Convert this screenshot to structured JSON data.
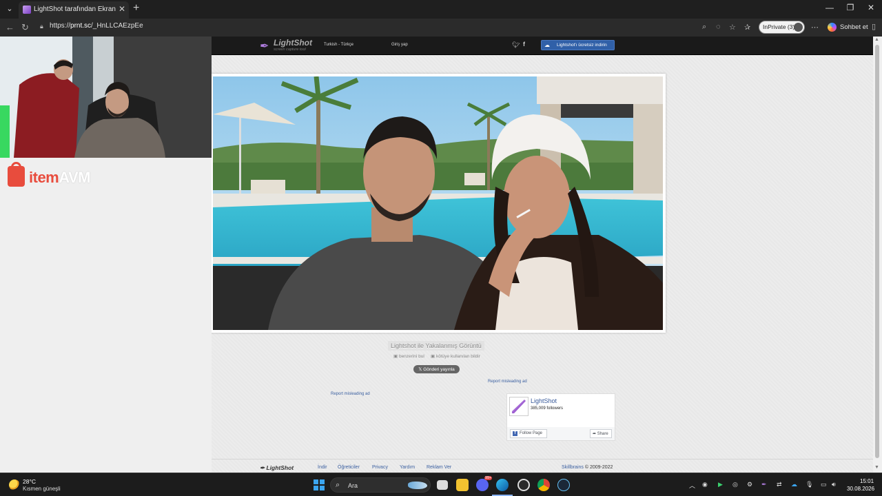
{
  "browser": {
    "tab_title": "LightShot tarafından Ekran Görüntü",
    "url_scheme": "https://",
    "url_host": "prnt.sc",
    "url_path": "/_HnLLCAEzpEe",
    "inprivate_label": "InPrivate (3)",
    "copilot_label": "Sohbet et",
    "icons": [
      "tab-menu-icon",
      "close-icon",
      "new-tab-icon",
      "minimize-icon",
      "maximize-icon",
      "window-close-icon",
      "back-icon",
      "refresh-icon",
      "lock-icon",
      "zoom-icon",
      "tracking-icon",
      "favorite-icon",
      "favorites-icon",
      "more-icon",
      "copilot-icon",
      "sidebar-icon"
    ]
  },
  "lightshot": {
    "header": {
      "logo_text": "LightShot",
      "logo_tagline": "screen capture tool",
      "language": "Turkish - Türkçe",
      "login": "Giriş yap",
      "download_button": "Lightshot'ı ücretsiz indirin"
    },
    "screenshot": {
      "caption": "Lightshot ile Yakalanmış Görüntü",
      "find_similar": "benzerini bul",
      "report_abuse": "kötüye kullanılan bildir",
      "tweet_button": "𝕏 Gönderi yayınla"
    },
    "ads": {
      "report_ad_1": "Report misleading ad",
      "report_ad_2": "Report misleading ad"
    },
    "facebook": {
      "page_name": "LightShot",
      "followers": "385,009 followers",
      "follow_button": "Follow Page",
      "share_button": "Share"
    },
    "footer": {
      "logo_text": "LightShot",
      "links": [
        "İndir",
        "Öğreticiler",
        "Privacy",
        "Yardım",
        "Reklam Ver"
      ],
      "copyright_brand": "Skillbrains",
      "copyright_text": " © 2009-2022"
    }
  },
  "sponsor": {
    "brand_a": "item",
    "brand_b": "AVM",
    "brand_color": "#e84c3d"
  },
  "taskbar": {
    "weather_temp": "28°C",
    "weather_desc": "Kısmen güneşli",
    "search_label": "Ara",
    "discord_badge": "99+",
    "clock_time": "15:01",
    "clock_date": "30.08.2026"
  }
}
